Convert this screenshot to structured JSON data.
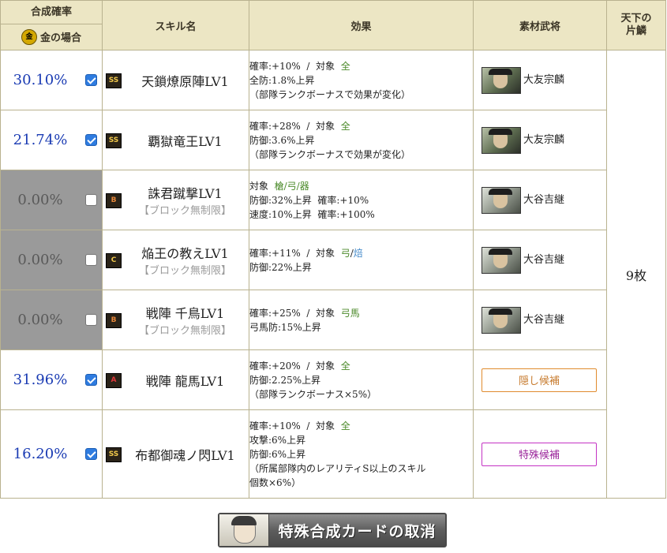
{
  "header": {
    "rate_title": "合成確率",
    "rate_sub": "金の場合",
    "skill": "スキル名",
    "effect": "効果",
    "material": "素材武将",
    "tenka": "天下の\n片鱗"
  },
  "rows": [
    {
      "rate": "30.10%",
      "checked": true,
      "rank": "SS",
      "name": "天鎖燎原陣LV1",
      "note": "",
      "effects": [
        [
          "確率:+10%  /  対象  ",
          "全",
          ""
        ],
        [
          "全防:1.8%上昇",
          "",
          ""
        ],
        [
          "（部隊ランクボーナスで効果が変化）",
          "",
          ""
        ]
      ],
      "material": {
        "type": "card",
        "name": "大友宗麟"
      }
    },
    {
      "rate": "21.74%",
      "checked": true,
      "rank": "SS",
      "name": "覇獄竜王LV1",
      "note": "",
      "effects": [
        [
          "確率:+28%  /  対象  ",
          "全",
          ""
        ],
        [
          "防御:3.6%上昇",
          "",
          ""
        ],
        [
          "（部隊ランクボーナスで効果が変化）",
          "",
          ""
        ]
      ],
      "material": {
        "type": "card",
        "name": "大友宗麟"
      }
    },
    {
      "rate": "0.00%",
      "checked": false,
      "rank": "B",
      "name": "誅君蹴撃LV1",
      "note": "【ブロック無制限】",
      "effects": [
        [
          "対象  ",
          "槍/弓/器",
          ""
        ],
        [
          "防御:32%上昇  確率:+10%",
          "",
          ""
        ],
        [
          "速度:10%上昇  確率:+100%",
          "",
          ""
        ]
      ],
      "material": {
        "type": "card",
        "name": "大谷吉継"
      }
    },
    {
      "rate": "0.00%",
      "checked": false,
      "rank": "C",
      "name": "焔王の教えLV1",
      "note": "【ブロック無制限】",
      "effects": [
        [
          "確率:+11%  /  対象  ",
          "弓",
          "焙"
        ],
        [
          "防御:22%上昇",
          "",
          ""
        ]
      ],
      "material": {
        "type": "card",
        "name": "大谷吉継"
      }
    },
    {
      "rate": "0.00%",
      "checked": false,
      "rank": "B",
      "name": "戦陣 千鳥LV1",
      "note": "【ブロック無制限】",
      "effects": [
        [
          "確率:+25%  /  対象  ",
          "弓馬",
          ""
        ],
        [
          "弓馬防:15%上昇",
          "",
          ""
        ]
      ],
      "material": {
        "type": "card",
        "name": "大谷吉継"
      }
    },
    {
      "rate": "31.96%",
      "checked": true,
      "rank": "A",
      "name": "戦陣 龍馬LV1",
      "note": "",
      "effects": [
        [
          "確率:+20%  /  対象  ",
          "全",
          ""
        ],
        [
          "防御:2.25%上昇",
          "",
          ""
        ],
        [
          "（部隊ランクボーナス×5%）",
          "",
          ""
        ]
      ],
      "material": {
        "type": "hidden",
        "name": "隠し候補"
      }
    },
    {
      "rate": "16.20%",
      "checked": true,
      "rank": "SS",
      "name": "布都御魂ノ閃LV1",
      "note": "",
      "effects": [
        [
          "確率:+10%  /  対象  ",
          "全",
          ""
        ],
        [
          "攻撃:6%上昇",
          "",
          ""
        ],
        [
          "防御:6%上昇",
          "",
          ""
        ],
        [
          "（所属部隊内のレアリティS以上のスキル",
          "",
          ""
        ],
        [
          "個数×6%）",
          "",
          ""
        ]
      ],
      "material": {
        "type": "special",
        "name": "特殊候補"
      }
    }
  ],
  "tenka_value": "9枚",
  "cancel_button": "特殊合成カードの取消",
  "colors": {
    "rate_blue": "#1a3bb3",
    "target_green": "#4b8a2a",
    "header_bg": "#ece6c4"
  }
}
